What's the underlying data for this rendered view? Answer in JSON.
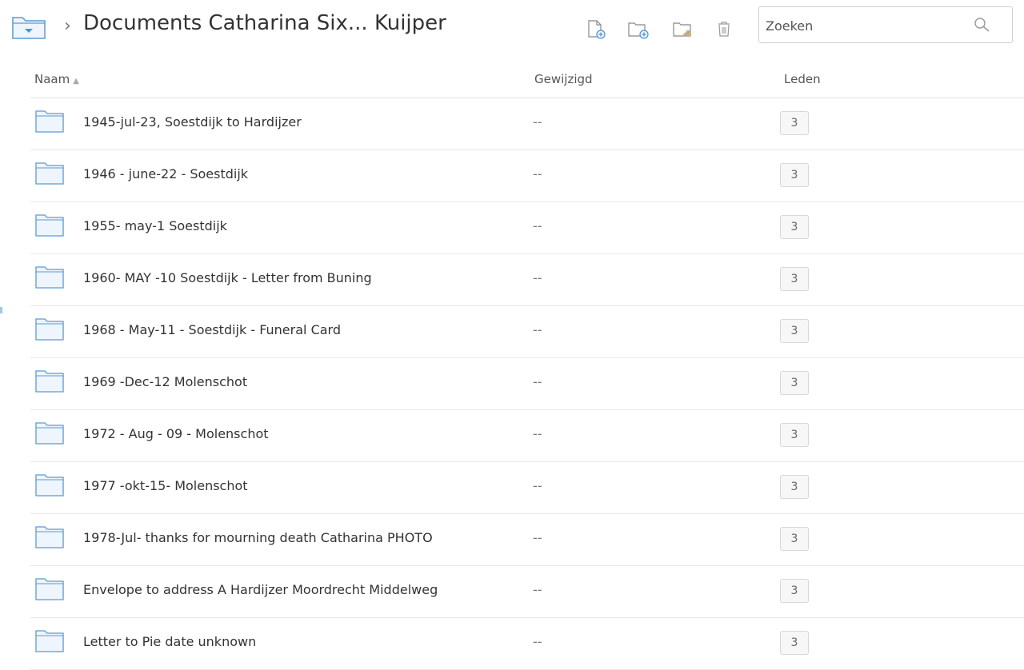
{
  "header": {
    "title": "Documents Catharina Six... Kuijper",
    "breadcrumb_separator": "›"
  },
  "toolbar": {
    "icons": [
      "new-file-icon",
      "new-folder-icon",
      "shared-folder-icon",
      "trash-icon"
    ]
  },
  "search": {
    "placeholder": "Zoeken",
    "value": ""
  },
  "table": {
    "columns": {
      "name": "Naam",
      "modified": "Gewijzigd",
      "members": "Leden"
    },
    "sort_indicator": "▲",
    "rows": [
      {
        "name": "1945-jul-23, Soestdijk to Hardijzer",
        "modified": "--",
        "members": "3"
      },
      {
        "name": "1946 - june-22 - Soestdijk",
        "modified": "--",
        "members": "3"
      },
      {
        "name": "1955- may-1 Soestdijk",
        "modified": "--",
        "members": "3"
      },
      {
        "name": "1960- MAY -10 Soestdijk - Letter from Buning",
        "modified": "--",
        "members": "3"
      },
      {
        "name": "1968 - May-11 - Soestdijk - Funeral Card",
        "modified": "--",
        "members": "3"
      },
      {
        "name": "1969 -Dec-12 Molenschot",
        "modified": "--",
        "members": "3"
      },
      {
        "name": "1972 - Aug - 09 - Molenschot",
        "modified": "--",
        "members": "3"
      },
      {
        "name": "1977 -okt-15- Molenschot",
        "modified": "--",
        "members": "3"
      },
      {
        "name": "1978-Jul- thanks for mourning death Catharina PHOTO",
        "modified": "--",
        "members": "3"
      },
      {
        "name": "Envelope to address A Hardijzer Moordrecht Middelweg",
        "modified": "--",
        "members": "3"
      },
      {
        "name": "Letter to Pie date unknown",
        "modified": "--",
        "members": "3"
      }
    ]
  },
  "colors": {
    "folder_fill": "#eef5fc",
    "folder_stroke": "#5b9bd5",
    "accent": "#4a90d9"
  }
}
